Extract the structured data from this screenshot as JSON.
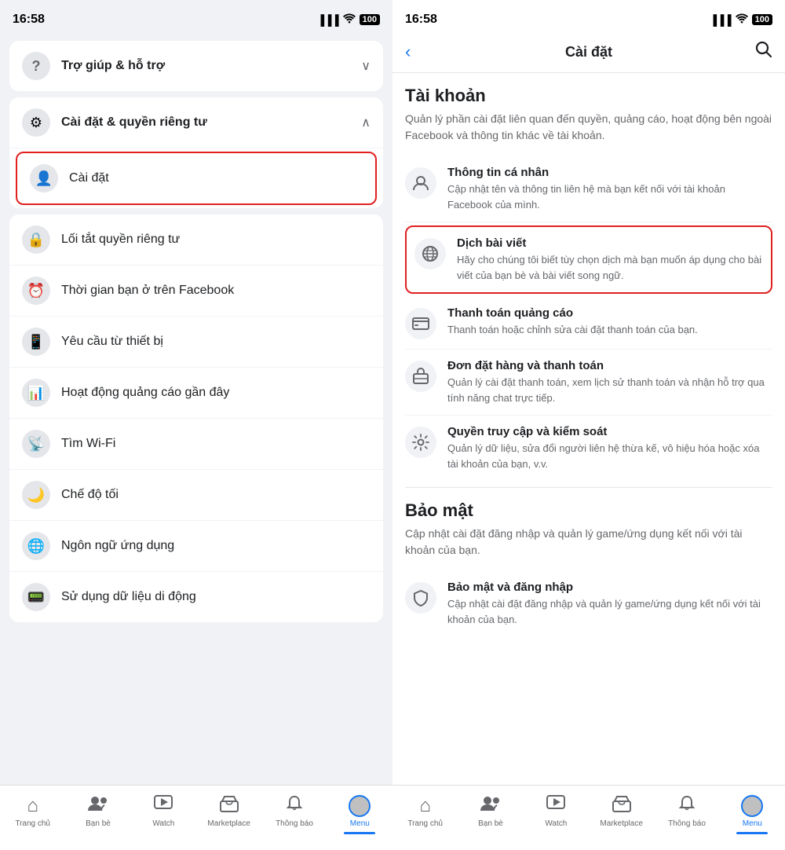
{
  "left": {
    "statusBar": {
      "time": "16:58",
      "signal": "▐▐▐▐",
      "wifi": "WiFi",
      "battery": "100"
    },
    "helpSection": {
      "label": "Trợ giúp & hỗ trợ",
      "chevron": "∨"
    },
    "settingsSection": {
      "label": "Cài đặt & quyền riêng tư",
      "chevron": "∧"
    },
    "caiDatItem": {
      "label": "Cài đặt"
    },
    "menuItems": [
      {
        "id": "loi-tat",
        "label": "Lối tắt quyền riêng tư",
        "icon": "🔒"
      },
      {
        "id": "thoi-gian",
        "label": "Thời gian bạn ở trên Facebook",
        "icon": "⏰"
      },
      {
        "id": "yeu-cau",
        "label": "Yêu cầu từ thiết bị",
        "icon": "📱"
      },
      {
        "id": "hoat-dong",
        "label": "Hoạt động quảng cáo gần đây",
        "icon": "📊"
      },
      {
        "id": "tim-wifi",
        "label": "Tìm Wi-Fi",
        "icon": "📡"
      },
      {
        "id": "che-do",
        "label": "Chế độ tối",
        "icon": "🌙"
      },
      {
        "id": "ngon-ngu",
        "label": "Ngôn ngữ ứng dụng",
        "icon": "🌐"
      },
      {
        "id": "su-dung",
        "label": "Sử dụng dữ liệu di động",
        "icon": "📟"
      }
    ],
    "bottomNav": {
      "items": [
        {
          "id": "trang-chu",
          "icon": "⌂",
          "label": "Trang chủ"
        },
        {
          "id": "ban-be",
          "icon": "👥",
          "label": "Bạn bè"
        },
        {
          "id": "watch",
          "icon": "▷",
          "label": "Watch"
        },
        {
          "id": "marketplace",
          "icon": "🏪",
          "label": "Marketplace"
        },
        {
          "id": "thong-bao",
          "icon": "🔔",
          "label": "Thông báo"
        },
        {
          "id": "menu",
          "icon": "☰",
          "label": "Menu"
        }
      ]
    }
  },
  "right": {
    "statusBar": {
      "time": "16:58",
      "signal": "▐▐▐▐",
      "wifi": "WiFi",
      "battery": "100"
    },
    "header": {
      "backLabel": "‹",
      "title": "Cài đặt",
      "searchIcon": "🔍"
    },
    "sections": [
      {
        "id": "tai-khoan",
        "title": "Tài khoản",
        "desc": "Quản lý phần cài đặt liên quan đến quyền, quảng cáo, hoạt động bên ngoài Facebook và thông tin khác về tài khoản.",
        "items": [
          {
            "id": "thong-tin",
            "icon": "👤",
            "title": "Thông tin cá nhân",
            "desc": "Cập nhật tên và thông tin liên hệ mà bạn kết nối với tài khoản Facebook của mình.",
            "highlighted": false
          },
          {
            "id": "dich-bai",
            "icon": "🌐",
            "title": "Dịch bài viết",
            "desc": "Hãy cho chúng tôi biết tùy chọn dịch mà bạn muốn áp dụng cho bài viết của bạn bè và bài viết song ngữ.",
            "highlighted": true
          },
          {
            "id": "thanh-toan-qc",
            "icon": "💳",
            "title": "Thanh toán quảng cáo",
            "desc": "Thanh toán hoặc chỉnh sửa cài đặt thanh toán của bạn.",
            "highlighted": false
          },
          {
            "id": "don-dat",
            "icon": "📦",
            "title": "Đơn đặt hàng và thanh toán",
            "desc": "Quản lý cài đặt thanh toán, xem lịch sử thanh toán và nhận hỗ trợ qua tính năng chat trực tiếp.",
            "highlighted": false
          },
          {
            "id": "quyen-truy",
            "icon": "⚙",
            "title": "Quyền truy cập và kiểm soát",
            "desc": "Quản lý dữ liệu, sửa đổi người liên hệ thừa kế, vô hiệu hóa hoặc xóa tài khoản của bạn, v.v.",
            "highlighted": false
          }
        ]
      },
      {
        "id": "bao-mat",
        "title": "Bảo mật",
        "desc": "Cập nhật cài đặt đăng nhập và quản lý game/ứng dụng kết nối với tài khoản của bạn.",
        "items": [
          {
            "id": "bao-mat-dang-nhap",
            "icon": "🛡",
            "title": "Bảo mật và đăng nhập",
            "desc": "Cập nhật cài đặt đăng nhập và quản lý game/ứng dụng kết nối với tài khoản của bạn.",
            "highlighted": false
          }
        ]
      }
    ],
    "bottomNav": {
      "items": [
        {
          "id": "trang-chu",
          "icon": "⌂",
          "label": "Trang chủ"
        },
        {
          "id": "ban-be",
          "icon": "👥",
          "label": "Bạn bè"
        },
        {
          "id": "watch",
          "icon": "▷",
          "label": "Watch"
        },
        {
          "id": "marketplace",
          "icon": "🏪",
          "label": "Marketplace"
        },
        {
          "id": "thong-bao",
          "icon": "🔔",
          "label": "Thông báo"
        },
        {
          "id": "menu",
          "icon": "☰",
          "label": "Menu"
        }
      ]
    }
  }
}
